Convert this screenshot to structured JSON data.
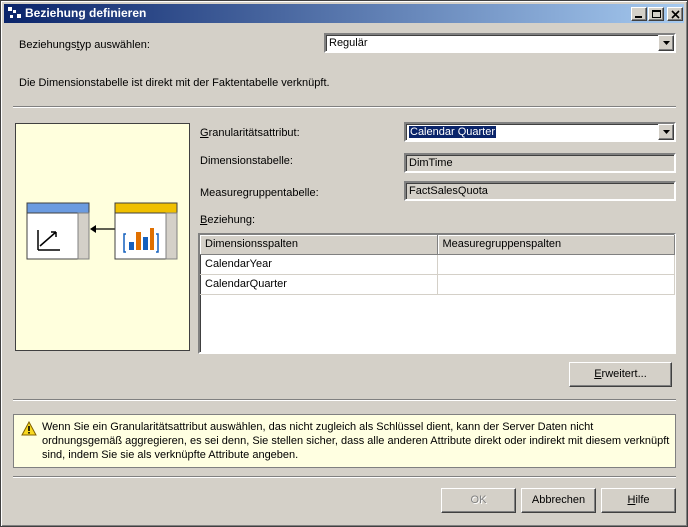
{
  "window": {
    "title": "Beziehung definieren"
  },
  "relationship_type": {
    "label_pre": "Beziehungs",
    "label_accel": "t",
    "label_post": "yp auswählen:",
    "value": "Regulär"
  },
  "description": "Die Dimensionstabelle ist direkt mit der Faktentabelle verknüpft.",
  "granularity": {
    "label_accel": "G",
    "label_post": "ranularitätsattribut:",
    "value": "Calendar Quarter"
  },
  "dimension_table": {
    "label": "Dimensionstabelle:",
    "value": "DimTime"
  },
  "measure_group_table": {
    "label": "Measuregruppentabelle:",
    "value": "FactSalesQuota"
  },
  "relationship": {
    "label_accel": "B",
    "label_post": "eziehung:",
    "columns": [
      "Dimensionsspalten",
      "Measuregruppenspalten"
    ],
    "rows": [
      [
        "CalendarYear",
        ""
      ],
      [
        "CalendarQuarter",
        ""
      ]
    ]
  },
  "buttons": {
    "advanced_accel": "E",
    "advanced_post": "rweitert...",
    "ok": "OK",
    "cancel": "Abbrechen",
    "help_accel": "H",
    "help_post": "ilfe"
  },
  "warning": "Wenn Sie ein Granularitätsattribut auswählen, das nicht zugleich als Schlüssel dient, kann der Server Daten nicht ordnungsgemäß aggregieren, es sei denn, Sie stellen sicher, dass alle anderen Attribute direkt oder indirekt mit diesem verknüpft sind, indem Sie sie als verknüpfte Attribute angeben.",
  "icons": {
    "app": "cube-icon",
    "minimize": "minimize-icon",
    "maximize": "maximize-icon",
    "close": "close-icon",
    "warning": "warning-icon",
    "dimension": "dimension-table-icon",
    "measure_group": "measure-group-chart-icon"
  },
  "colors": {
    "title_start": "#0a246a",
    "title_end": "#a6caf0",
    "preview_bg": "#ffffdd",
    "warning_bg": "#ffffe1",
    "selection": "#0a246a"
  }
}
